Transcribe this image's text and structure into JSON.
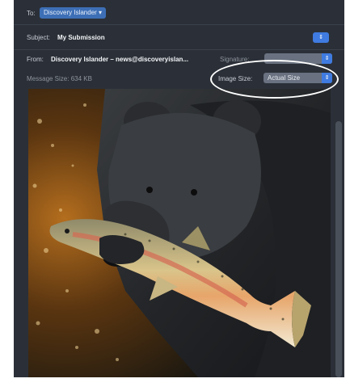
{
  "header": {
    "to_label": "To:",
    "to_value": "Discovery Islander",
    "subject_label": "Subject:",
    "subject_value": "My Submission",
    "from_label": "From:",
    "from_value": "Discovery Islander – news@discoveryislan...",
    "signature_label": "Signature:",
    "message_size_label": "Message Size: 634 KB",
    "image_size_label": "Image Size:",
    "image_size_value": "Actual Size"
  },
  "colors": {
    "accent": "#3f7be0",
    "recipient_token": "#3d6fb6",
    "panel": "#2b3038",
    "highlight_ellipse": "#ffffff"
  },
  "icons": {
    "popup_chevron": "chevron-updown-icon",
    "stepper": "stepper-icon"
  },
  "attachment": {
    "alt": "Black bear holding a trout in its mouth"
  }
}
